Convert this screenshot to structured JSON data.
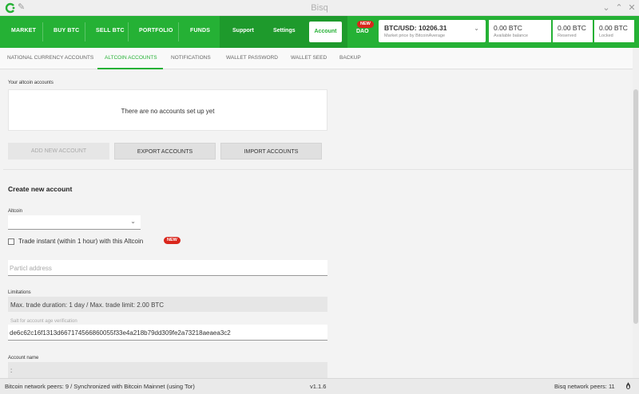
{
  "window": {
    "title": "Bisq"
  },
  "nav": {
    "market": "MARKET",
    "buy_btc": "BUY BTC",
    "sell_btc": "SELL BTC",
    "portfolio": "PORTFOLIO",
    "funds": "FUNDS",
    "support": "Support",
    "settings": "Settings",
    "account": "Account",
    "dao": "DAO",
    "new_badge": "NEW"
  },
  "price": {
    "main": "BTC/USD: 10206.31",
    "sub": "Market price by BitcoinAverage"
  },
  "balances": [
    {
      "value": "0.00 BTC",
      "label": "Available balance"
    },
    {
      "value": "0.00 BTC",
      "label": "Reserved"
    },
    {
      "value": "0.00 BTC",
      "label": "Locked"
    }
  ],
  "subtabs": [
    "NATIONAL CURRENCY ACCOUNTS",
    "ALTCOIN ACCOUNTS",
    "NOTIFICATIONS",
    "WALLET PASSWORD",
    "WALLET SEED",
    "BACKUP"
  ],
  "accounts": {
    "section_label": "Your altcoin accounts",
    "empty": "There are no accounts set up yet",
    "add": "ADD NEW ACCOUNT",
    "export": "EXPORT ACCOUNTS",
    "import": "IMPORT ACCOUNTS"
  },
  "create": {
    "title": "Create new account",
    "altcoin_label": "Altcoin",
    "trade_instant": "Trade instant (within 1 hour) with this Altcoin",
    "new_badge": "NEW",
    "address_placeholder": "Particl address",
    "limitations_label": "Limitations",
    "limitations_value": "Max. trade duration: 1 day / Max. trade limit: 2.00 BTC",
    "salt_label": "Salt for account age verification",
    "salt_value": "de6c62c16f1313d667174566860055f33e4a218b79dd309fe2a73218aeaea3c2",
    "account_name_label": "Account name",
    "account_name_value": ":"
  },
  "footer": {
    "left": "Bitcoin network peers: 9 / Synchronized with Bitcoin Mainnet (using Tor)",
    "version": "v1.1.6",
    "right": "Bisq network peers: 11"
  },
  "colors": {
    "accent": "#25b135",
    "badge": "#d9261c"
  }
}
